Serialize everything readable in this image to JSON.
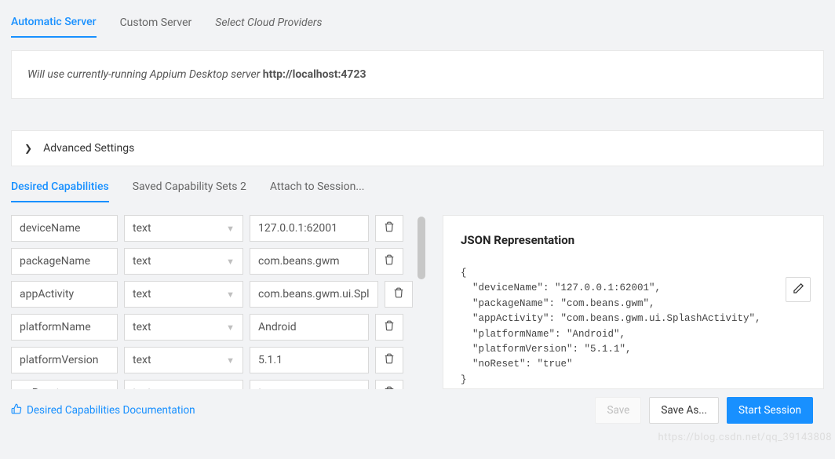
{
  "top_tabs": {
    "automatic": "Automatic Server",
    "custom": "Custom Server",
    "cloud": "Select Cloud Providers"
  },
  "info": {
    "prefix": "Will use currently-running Appium Desktop server ",
    "url": "http://localhost:4723"
  },
  "advanced_label": "Advanced Settings",
  "sub_tabs": {
    "desired": "Desired Capabilities",
    "saved": "Saved Capability Sets 2",
    "attach": "Attach to Session..."
  },
  "caps": [
    {
      "name": "deviceName",
      "type": "text",
      "value": "127.0.0.1:62001"
    },
    {
      "name": "packageName",
      "type": "text",
      "value": "com.beans.gwm"
    },
    {
      "name": "appActivity",
      "type": "text",
      "value": "com.beans.gwm.ui.Spl"
    },
    {
      "name": "platformName",
      "type": "text",
      "value": "Android"
    },
    {
      "name": "platformVersion",
      "type": "text",
      "value": "5.1.1"
    },
    {
      "name": "noReset",
      "type": "text",
      "value": "true"
    }
  ],
  "json_panel": {
    "title": "JSON Representation",
    "lines": [
      "{",
      "  \"deviceName\": \"127.0.0.1:62001\",",
      "  \"packageName\": \"com.beans.gwm\",",
      "  \"appActivity\": \"com.beans.gwm.ui.SplashActivity\",",
      "  \"platformName\": \"Android\",",
      "  \"platformVersion\": \"5.1.1\",",
      "  \"noReset\": \"true\"",
      "}"
    ]
  },
  "doc_link": "Desired Capabilities Documentation",
  "buttons": {
    "save": "Save",
    "save_as": "Save As...",
    "start": "Start Session"
  },
  "watermark": "https://blog.csdn.net/qq_39143808"
}
